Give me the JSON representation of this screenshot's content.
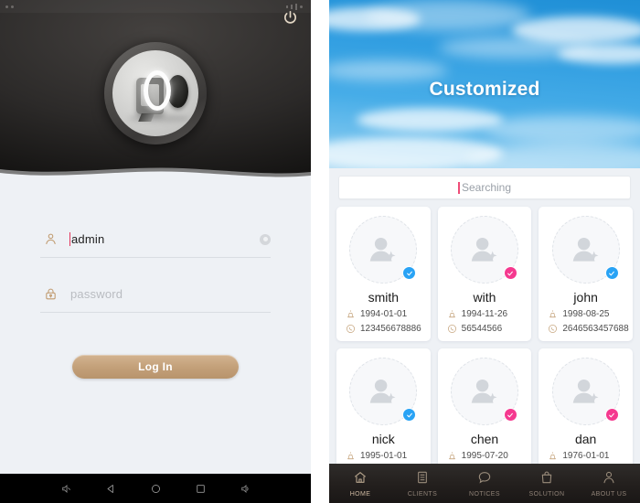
{
  "login": {
    "power_icon": "power-icon",
    "logo": "app-logo",
    "username": {
      "icon": "user-icon",
      "value": "admin",
      "clear_icon": "clear-icon"
    },
    "password": {
      "icon": "lock-icon",
      "placeholder": "password",
      "value": ""
    },
    "submit_label": "Log In",
    "nav_items": [
      {
        "name": "volume-down-icon"
      },
      {
        "name": "back-icon"
      },
      {
        "name": "home-icon"
      },
      {
        "name": "recents-icon"
      },
      {
        "name": "volume-up-icon"
      }
    ]
  },
  "contacts": {
    "banner_title": "Customized",
    "search": {
      "placeholder": "Searching",
      "value": ""
    },
    "cards": [
      {
        "name": "smith",
        "birthday": "1994-01-01",
        "phone": "123456678886",
        "badge_color": "#29a3f5",
        "badge_icon": "verified-icon"
      },
      {
        "name": "with",
        "birthday": "1994-11-26",
        "phone": "56544566",
        "badge_color": "#f5398f",
        "badge_icon": "verified-icon"
      },
      {
        "name": "john",
        "birthday": "1998-08-25",
        "phone": "2646563457688",
        "badge_color": "#29a3f5",
        "badge_icon": "verified-icon"
      },
      {
        "name": "nick",
        "birthday": "1995-01-01",
        "phone": "",
        "badge_color": "#29a3f5",
        "badge_icon": "verified-icon"
      },
      {
        "name": "chen",
        "birthday": "1995-07-20",
        "phone": "",
        "badge_color": "#f5398f",
        "badge_icon": "verified-icon"
      },
      {
        "name": "dan",
        "birthday": "1976-01-01",
        "phone": "",
        "badge_color": "#f5398f",
        "badge_icon": "verified-icon"
      }
    ],
    "tabs": [
      {
        "label": "HOME",
        "icon": "house-icon",
        "active": true
      },
      {
        "label": "CLIENTS",
        "icon": "document-icon",
        "active": false
      },
      {
        "label": "NOTICES",
        "icon": "chat-bubble-icon",
        "active": false
      },
      {
        "label": "SOLUTION",
        "icon": "bag-icon",
        "active": false
      },
      {
        "label": "ABOUT US",
        "icon": "person-icon",
        "active": false
      }
    ]
  },
  "colors": {
    "accent_tan": "#c3a079",
    "badge_blue": "#29a3f5",
    "badge_pink": "#f5398f",
    "cursor_pink": "#ef4d78"
  }
}
